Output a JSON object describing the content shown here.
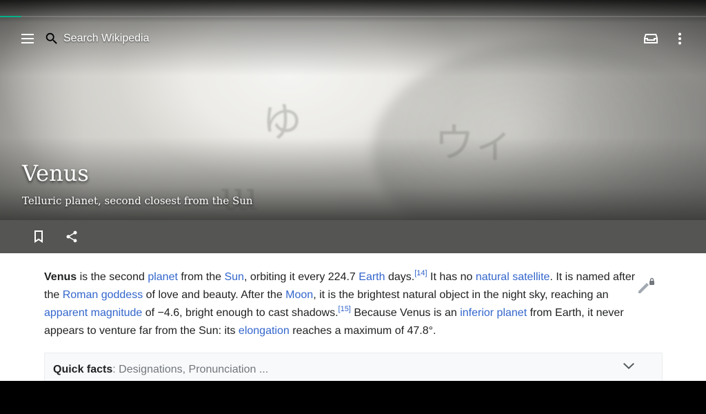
{
  "header": {
    "search_placeholder": "Search Wikipedia",
    "menu_icon": "menu-icon",
    "search_icon": "search-icon",
    "reading_lists_icon": "reading-list-icon",
    "overflow_icon": "more-vert-icon"
  },
  "article": {
    "title": "Venus",
    "description": "Telluric planet, second closest from the Sun",
    "lead": {
      "t1": "Venus",
      "t2": " is the second ",
      "l_planet": "planet",
      "t3": " from the ",
      "l_sun": "Sun",
      "t4": ", orbiting it every 224.7 ",
      "l_earth": "Earth",
      "t5": " days.",
      "ref14": "[14]",
      "t6": " It has no ",
      "l_natural_satellite": "natural satellite",
      "t7": ". It is named after the ",
      "l_roman_goddess": "Roman goddess",
      "t8": " of love and beauty. After the ",
      "l_moon": "Moon",
      "t9": ", it is the brightest natural object in the night sky, reaching an ",
      "l_apparent_magnitude": "apparent magnitude",
      "t10": " of −4.6, bright enough to cast shadows.",
      "ref15": "[15]",
      "t11": " Because Venus is an ",
      "l_inferior_planet": "inferior planet",
      "t12": " from Earth, it never appears to venture far from the Sun: its ",
      "l_elongation": "elongation",
      "t13": " reaches a maximum of 47.8°."
    }
  },
  "actions": {
    "bookmark_icon": "bookmark-icon",
    "share_icon": "share-icon"
  },
  "quick_facts": {
    "label": "Quick facts",
    "sub": ": Designations, Pronunciation ..."
  },
  "colors": {
    "link": "#3366cc",
    "accent_progress": "#00af89",
    "action_bar": "#555553"
  }
}
